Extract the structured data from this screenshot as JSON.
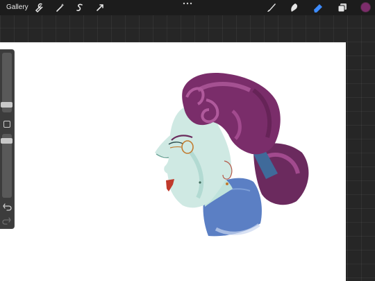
{
  "topbar": {
    "gallery_label": "Gallery",
    "left_tools": [
      "wrench-icon",
      "magic-wand-icon",
      "selection-icon",
      "transform-icon"
    ],
    "right_tools": [
      "brush-icon",
      "smudge-icon",
      "eraser-icon",
      "layers-icon"
    ],
    "active_tool": "eraser-icon",
    "active_tool_color": "#3d8bff",
    "current_color": "#7c2d6b"
  },
  "sidebar": {
    "brush_size_level": 0.55,
    "opacity_level": 0.15,
    "icons": [
      "modify-button",
      "undo-icon",
      "redo-icon"
    ]
  },
  "canvas": {
    "background": "#ffffff",
    "artwork": "portrait-profile-painting",
    "palette": {
      "hair": "#7a2d6a",
      "hair_light": "#a24a8e",
      "skin": "#cfe9e3",
      "skin_shadow": "#9fd0c6",
      "collar": "#5b7fc4",
      "band": "#3f6a9a",
      "lips": "#c0392b"
    }
  }
}
